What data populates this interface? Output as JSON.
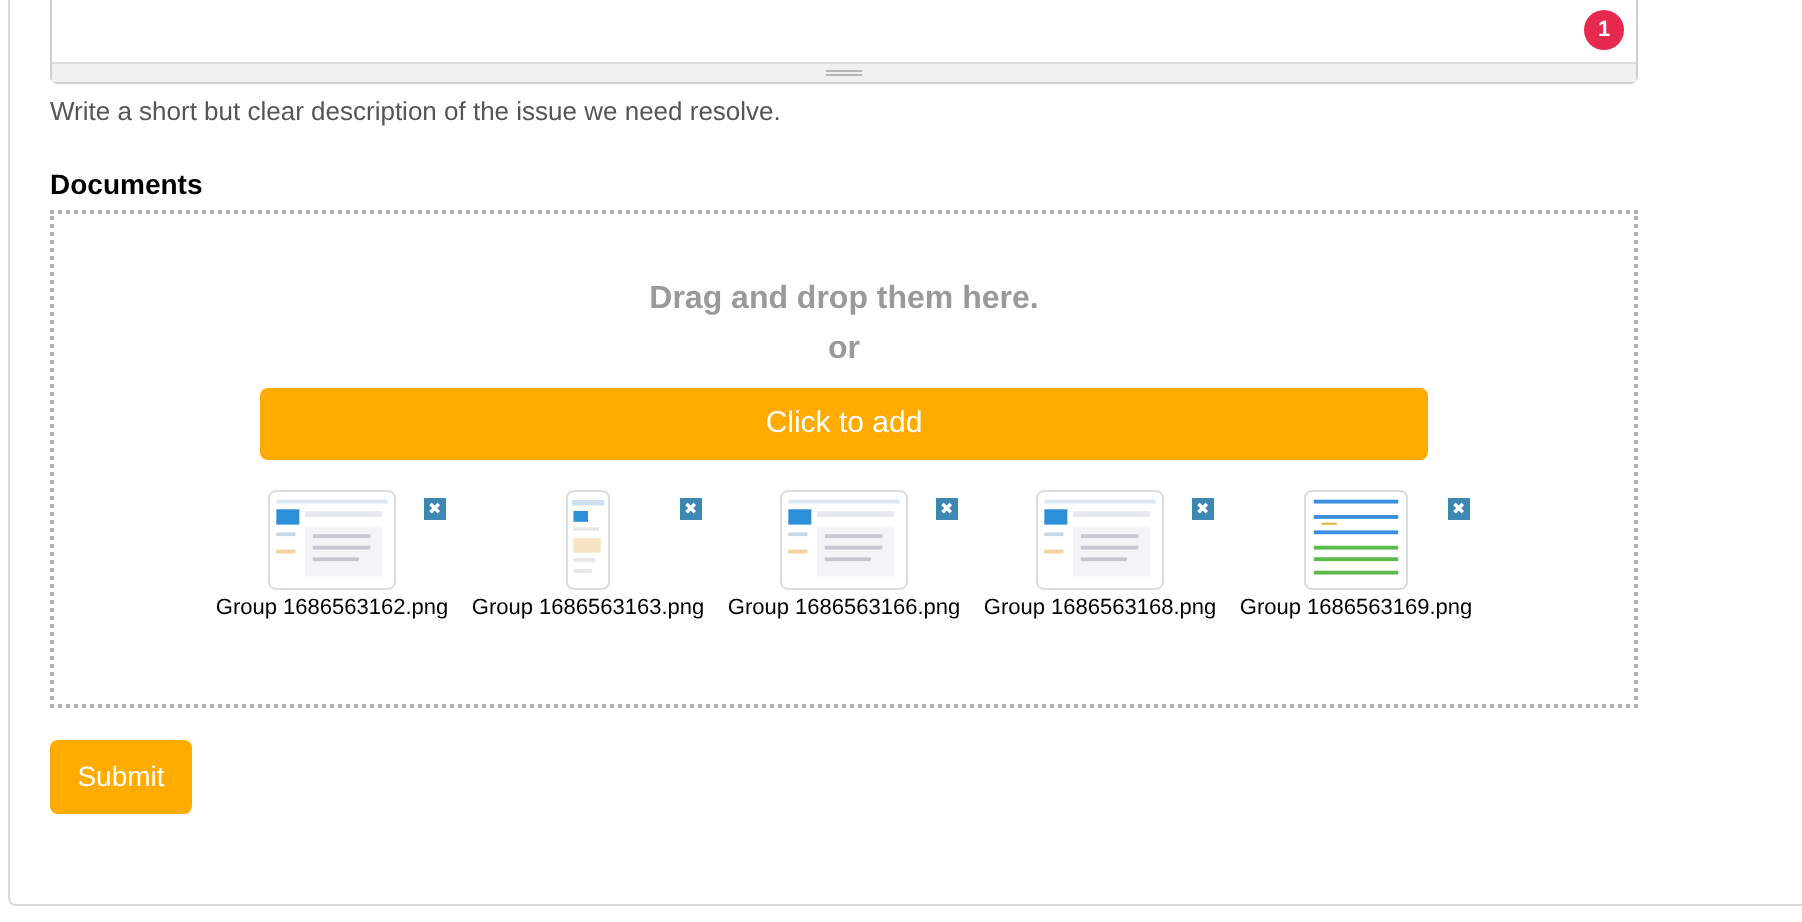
{
  "description_field": {
    "badge": "1",
    "help": "Write a short but clear description of the issue we need resolve."
  },
  "documents": {
    "label": "Documents",
    "drop_text": "Drag and drop them here.",
    "or_text": "or",
    "add_button": "Click to add",
    "files": [
      {
        "name": "Group 1686563162.png",
        "kind": "wide",
        "remove": "✖"
      },
      {
        "name": "Group 1686563163.png",
        "kind": "narrow",
        "remove": "✖"
      },
      {
        "name": "Group 1686563166.png",
        "kind": "wide",
        "remove": "✖"
      },
      {
        "name": "Group 1686563168.png",
        "kind": "wide",
        "remove": "✖"
      },
      {
        "name": "Group 1686563169.png",
        "kind": "list",
        "remove": "✖"
      }
    ]
  },
  "submit": "Submit"
}
